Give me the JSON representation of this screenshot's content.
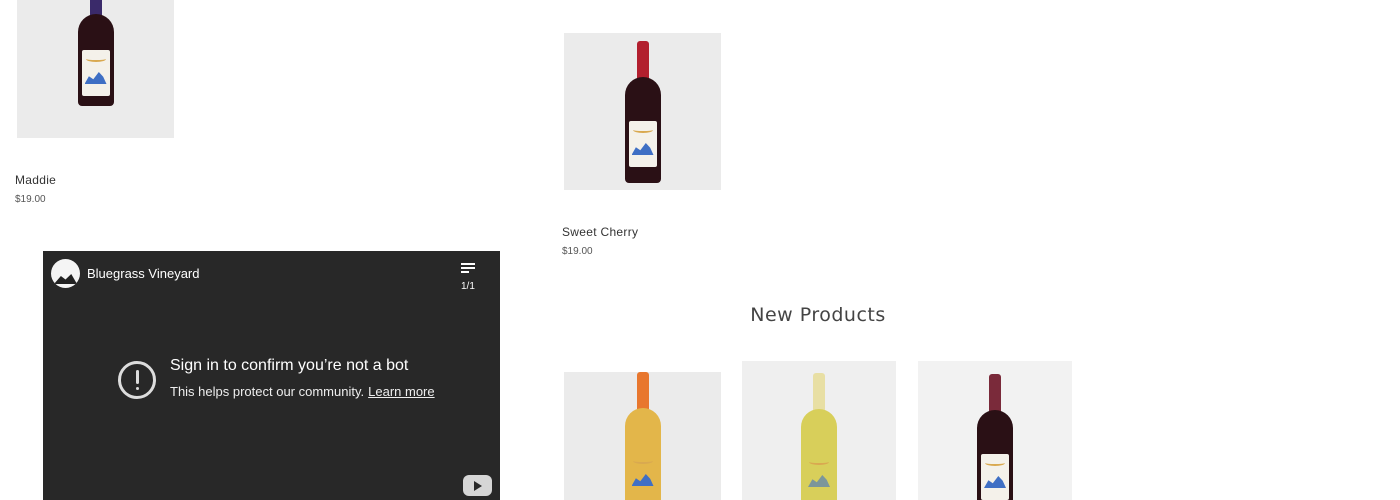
{
  "products_top": [
    {
      "name": "Maddie",
      "price": "$19.00",
      "bottle": "red"
    },
    {
      "name": "Sweet Cherry",
      "price": "$19.00",
      "bottle": "red"
    }
  ],
  "new_products": {
    "title": "New Products",
    "items": [
      {
        "bottle": "amber"
      },
      {
        "bottle": "white"
      },
      {
        "bottle": "red"
      }
    ]
  },
  "video": {
    "channel": "Bluegrass Vineyard",
    "playlist_count": "1/1",
    "message_title": "Sign in to confirm you’re not a bot",
    "message_body": "This helps protect our community.",
    "learn_more": "Learn more"
  },
  "colors": {
    "red_wine": "#2a1015",
    "red_capsule": "#b21f2e",
    "amber_wine": "#e3b64a",
    "amber_capsule": "#e8772e",
    "white_wine": "#d8cf5a",
    "white_capsule": "#e8dfa4",
    "video_bg": "#282828"
  }
}
